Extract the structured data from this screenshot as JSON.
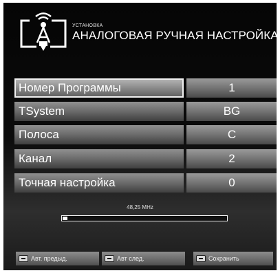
{
  "header": {
    "subtitle": "УСТАНОВКА",
    "title": "АНАЛОГОВАЯ РУЧНАЯ НАСТРОЙКА"
  },
  "settings": [
    {
      "label": "Номер Программы",
      "value": "1",
      "selected": true
    },
    {
      "label": "TSystem",
      "value": "BG"
    },
    {
      "label": "Полоса",
      "value": "C"
    },
    {
      "label": "Канал",
      "value": "2"
    },
    {
      "label": "Точная настройка",
      "value": "0"
    }
  ],
  "tuning": {
    "frequency": "48,25 MHz",
    "progress": 0.03
  },
  "buttons": {
    "prev": "Авт. предыд.",
    "next": "Авт след.",
    "save": "Сохранить"
  },
  "icons": {
    "header": "antenna-signal-icon",
    "button_key": "remote-key-icon"
  }
}
